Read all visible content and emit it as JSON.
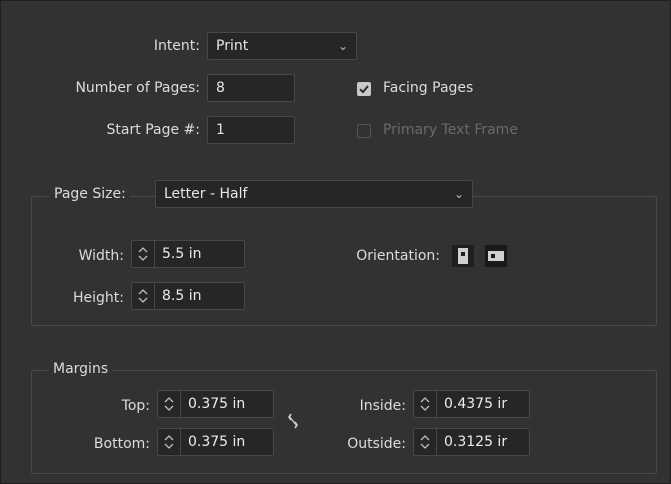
{
  "intent": {
    "label": "Intent:",
    "value": "Print"
  },
  "pages": {
    "label": "Number of Pages:",
    "value": "8"
  },
  "start_page": {
    "label": "Start Page #:",
    "value": "1"
  },
  "facing_pages": {
    "label": "Facing Pages",
    "checked": true
  },
  "primary_text_frame": {
    "label": "Primary Text Frame",
    "checked": false,
    "disabled": true
  },
  "page_size": {
    "label": "Page Size:",
    "value": "Letter - Half",
    "width": {
      "label": "Width:",
      "value": "5.5 in"
    },
    "height": {
      "label": "Height:",
      "value": "8.5 in"
    },
    "orientation": {
      "label": "Orientation:",
      "selected": "portrait"
    }
  },
  "margins": {
    "title": "Margins",
    "top": {
      "label": "Top:",
      "value": "0.375 in"
    },
    "bottom": {
      "label": "Bottom:",
      "value": "0.375 in"
    },
    "inside": {
      "label": "Inside:",
      "value": "0.4375 ir"
    },
    "outside": {
      "label": "Outside:",
      "value": "0.3125 ir"
    }
  }
}
